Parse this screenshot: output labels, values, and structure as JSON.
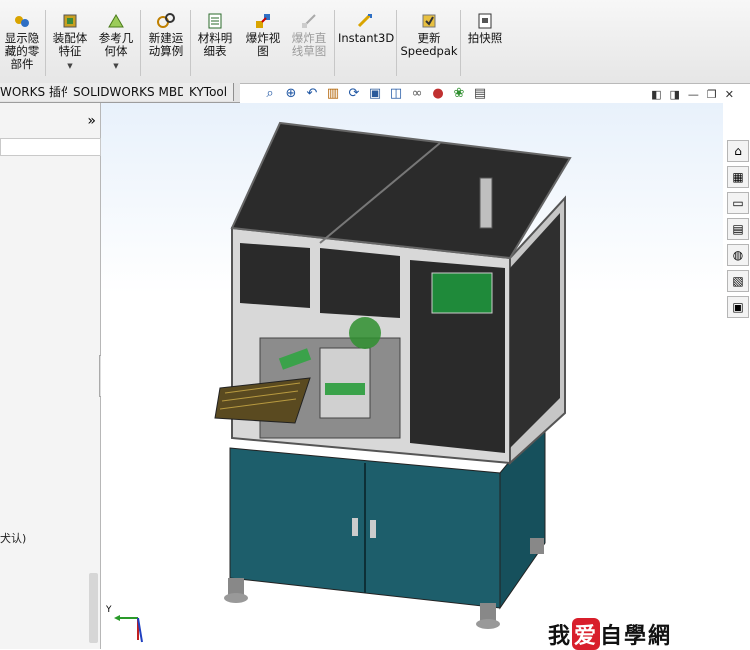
{
  "ribbon": {
    "buttons": [
      {
        "label": "显示隐\n藏的零\n部件",
        "icon": "show-hidden-icon",
        "disabled": false,
        "dropdown": false
      },
      {
        "label": "装配体\n特征",
        "icon": "assembly-feature-icon",
        "disabled": false,
        "dropdown": true
      },
      {
        "label": "参考几\n何体",
        "icon": "reference-geometry-icon",
        "disabled": false,
        "dropdown": true
      },
      {
        "label": "新建运\n动算例",
        "icon": "motion-study-icon",
        "disabled": false,
        "dropdown": false
      },
      {
        "label": "材料明\n细表",
        "icon": "bill-of-materials-icon",
        "disabled": false,
        "dropdown": false
      },
      {
        "label": "爆炸视\n图",
        "icon": "exploded-view-icon",
        "disabled": false,
        "dropdown": false
      },
      {
        "label": "爆炸直\n线草图",
        "icon": "explode-line-sketch-icon",
        "disabled": true,
        "dropdown": false
      },
      {
        "label": "Instant3D",
        "icon": "instant3d-icon",
        "disabled": false,
        "dropdown": false
      },
      {
        "label": "更新\nSpeedpak",
        "icon": "speedpak-icon",
        "disabled": false,
        "dropdown": false
      },
      {
        "label": "拍快照",
        "icon": "snapshot-icon",
        "disabled": false,
        "dropdown": false
      }
    ]
  },
  "tabs": [
    "WORKS 插件",
    "SOLIDWORKS MBD",
    "KYTool"
  ],
  "left_panel": {
    "collapse_glyph": "»",
    "truncated_text": "犬认)"
  },
  "splitter_glyph": "⋮",
  "view_toolbar": [
    "zoom-to-fit-icon",
    "zoom-area-icon",
    "previous-view-icon",
    "section-view-icon",
    "dynamic-annotation-icon",
    "view-orientation-icon",
    "display-style-icon",
    "hide-show-items-icon",
    "edit-appearance-icon",
    "apply-scene-icon",
    "view-settings-icon"
  ],
  "taskpane_icons": [
    "home-icon",
    "resources-icon",
    "file-explorer-icon",
    "view-palette-icon",
    "appearances-icon",
    "custom-properties-icon",
    "forum-icon"
  ],
  "watermark": {
    "part1": "我",
    "part2": "爱",
    "part3": "自學網"
  },
  "triad": {
    "y_label": "Y"
  },
  "colors": {
    "panel_dark": "#2b2b2b",
    "cabinet": "#1d5e6b",
    "screen": "#1f8a3a",
    "accent_green": "#3aa24a"
  }
}
